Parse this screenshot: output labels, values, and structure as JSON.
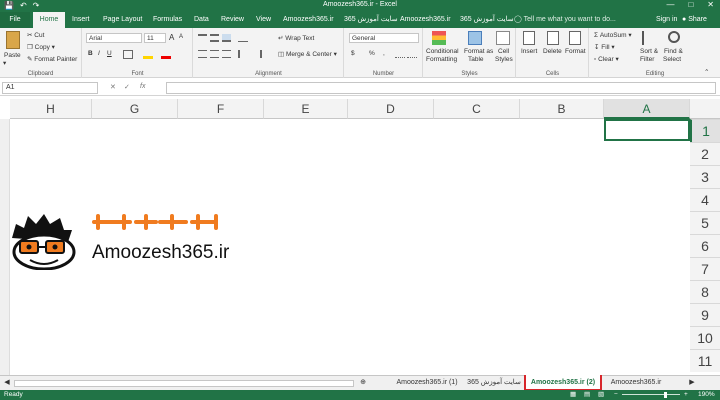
{
  "titlebar": {
    "title": "Amoozesh365.ir - Excel",
    "qat": {
      "save": "save-icon",
      "undo": "undo-icon",
      "redo": "redo-icon"
    },
    "window_buttons": [
      "minimize-icon",
      "restore-icon",
      "close-icon"
    ]
  },
  "tabs": [
    "File",
    "Home",
    "Insert",
    "Page Layout",
    "Formulas",
    "Data",
    "Review",
    "View",
    "Amoozesh365.ir",
    "سایت آموزش 365",
    "Amoozesh365.ir",
    "سایت آموزش 365"
  ],
  "tell_me": "Tell me what you want to do...",
  "sign_in": "Sign in",
  "share": "Share",
  "ribbon": {
    "clipboard": {
      "paste": "Paste",
      "cut": "Cut",
      "copy": "Copy",
      "format_painter": "Format Painter",
      "label": "Clipboard"
    },
    "font": {
      "name": "Arial",
      "size": "11",
      "bold": "B",
      "italic": "I",
      "underline": "U",
      "grow": "A",
      "shrink": "A",
      "label": "Font"
    },
    "alignment": {
      "wrap": "Wrap Text",
      "merge": "Merge & Center",
      "label": "Alignment"
    },
    "number": {
      "format": "General",
      "currency": "$",
      "percent": "%",
      "comma": ",",
      "label": "Number"
    },
    "styles": {
      "conditional": "Conditional",
      "conditional2": "Formatting",
      "format_as": "Format as",
      "table": "Table",
      "cell": "Cell",
      "styles": "Styles",
      "label": "Styles"
    },
    "cells": {
      "insert": "Insert",
      "delete": "Delete",
      "format": "Format",
      "label": "Cells"
    },
    "editing": {
      "autosum": "AutoSum",
      "fill": "Fill",
      "clear": "Clear",
      "sort": "Sort &",
      "filter": "Filter",
      "find": "Find &",
      "select": "Select",
      "label": "Editing"
    }
  },
  "formula_bar": {
    "name_box": "A1",
    "fx": "fx",
    "value": ""
  },
  "columns": [
    "H",
    "G",
    "F",
    "E",
    "D",
    "C",
    "B",
    "A"
  ],
  "rows": [
    "1",
    "2",
    "3",
    "4",
    "5",
    "6",
    "7",
    "8",
    "9",
    "10",
    "11"
  ],
  "logo": {
    "persian": "آموزش ۳۶۵",
    "site": "Amoozesh365.ir"
  },
  "sheets": [
    "Amoozesh365.ir (1)",
    "سایت آموزش 365",
    "Amoozesh365.ir (2)",
    "Amoozesh365.ir"
  ],
  "active_sheet_index": 2,
  "status": {
    "ready": "Ready",
    "zoom": "190%"
  },
  "colors": {
    "accent": "#217346",
    "highlight": "#d7262b",
    "logo_orange": "#f07b1f"
  }
}
